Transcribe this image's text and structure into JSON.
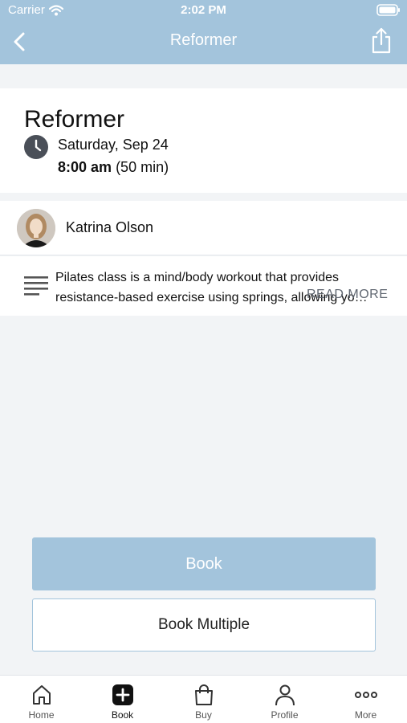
{
  "status": {
    "carrier": "Carrier",
    "time": "2:02 PM"
  },
  "nav": {
    "title": "Reformer"
  },
  "class_info": {
    "name": "Reformer",
    "date": "Saturday, Sep 24",
    "time_bold": "8:00 am",
    "duration": "(50 min)"
  },
  "instructor": {
    "name": "Katrina Olson"
  },
  "description": {
    "text": "Pilates class is a mind/body workout that provides resistance-based exercise using springs, allowing yo…",
    "read_more": "READ MORE"
  },
  "actions": {
    "book": "Book",
    "book_multiple": "Book Multiple"
  },
  "tabs": [
    {
      "label": "Home",
      "icon": "home-icon"
    },
    {
      "label": "Book",
      "icon": "book-plus-icon"
    },
    {
      "label": "Buy",
      "icon": "shopping-bag-icon"
    },
    {
      "label": "Profile",
      "icon": "person-icon"
    },
    {
      "label": "More",
      "icon": "more-dots-icon"
    }
  ],
  "colors": {
    "accent": "#a3c4dc",
    "background": "#f2f4f6"
  }
}
